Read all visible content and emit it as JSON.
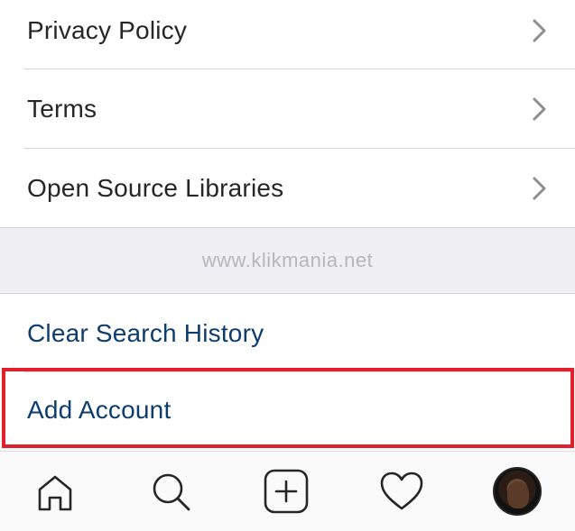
{
  "menu": {
    "items": [
      {
        "label": "Privacy Policy"
      },
      {
        "label": "Terms"
      },
      {
        "label": "Open Source Libraries"
      }
    ]
  },
  "watermark": {
    "text": "www.klikmania.net"
  },
  "actions": {
    "clear_search_history": "Clear Search History",
    "add_account": "Add Account"
  },
  "colors": {
    "link_blue": "#0d3d6e",
    "highlight_red": "#e0212b",
    "text_dark": "#262626",
    "band_gray": "#efeff4"
  },
  "tabbar": {
    "icons": [
      "home-icon",
      "search-icon",
      "new-post-icon",
      "activity-heart-icon",
      "profile-avatar"
    ]
  }
}
